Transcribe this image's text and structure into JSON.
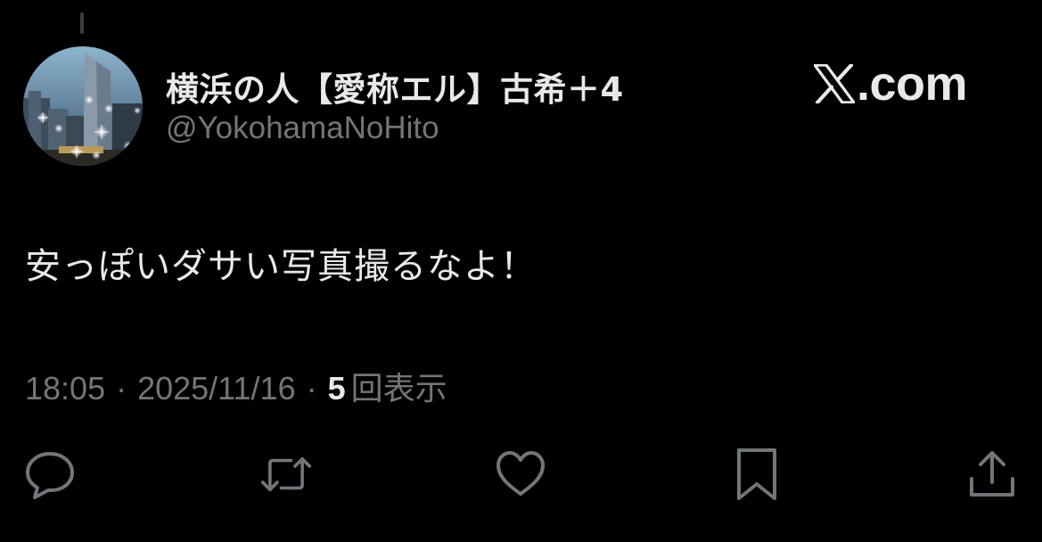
{
  "post": {
    "author": {
      "display_name": "横浜の人【愛称エル】古希＋4",
      "handle": "@YokohamaNoHito"
    },
    "brand": {
      "logo_icon": "x-logo-icon",
      "domain": ".com"
    },
    "text": "安っぽいダサい写真撮るなよ！",
    "meta": {
      "time": "18:05",
      "separator": "·",
      "date": "2025/11/16",
      "views_count": "5",
      "views_label": "回表示"
    },
    "actions": [
      {
        "name": "reply",
        "icon": "speech-bubble-icon"
      },
      {
        "name": "repost",
        "icon": "repost-arrows-icon"
      },
      {
        "name": "like",
        "icon": "heart-icon"
      },
      {
        "name": "bookmark",
        "icon": "bookmark-icon"
      },
      {
        "name": "share",
        "icon": "share-upload-icon"
      }
    ]
  },
  "colors": {
    "background": "#000000",
    "primary_text": "#e7e9ea",
    "secondary_text": "#71767b",
    "icon": "#71767b"
  }
}
